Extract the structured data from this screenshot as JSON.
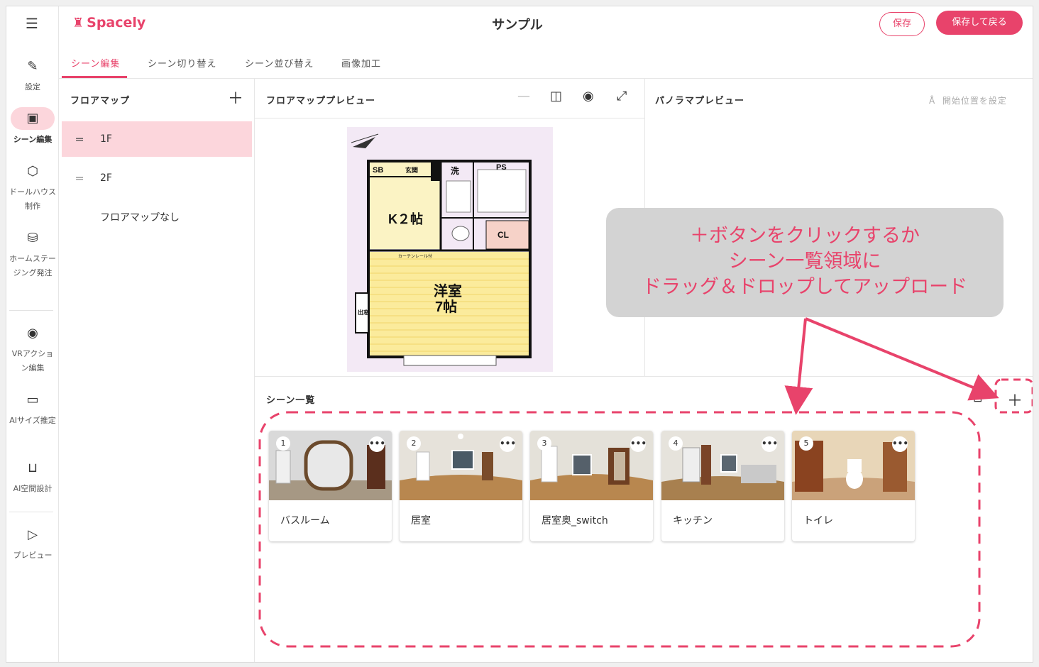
{
  "app": {
    "brand": "Spacely",
    "title": "サンプル",
    "save_label": "保存",
    "save_back_label": "保存して戻る"
  },
  "rail": {
    "items": [
      {
        "label": "設定",
        "icon": "pencil-icon"
      },
      {
        "label": "シーン編集",
        "icon": "image-icon"
      },
      {
        "label": "ドールハウス制作",
        "icon": "cube-icon"
      },
      {
        "label": "ホームステージング発注",
        "icon": "staging-icon"
      },
      {
        "label": "VRアクション編集",
        "icon": "target-icon"
      },
      {
        "label": "AIサイズ推定",
        "icon": "ruler-icon"
      },
      {
        "label": "AI空間設計",
        "icon": "sofa-icon"
      },
      {
        "label": "プレビュー",
        "icon": "play-icon"
      }
    ]
  },
  "tabs": [
    {
      "label": "シーン編集"
    },
    {
      "label": "シーン切り替え"
    },
    {
      "label": "シーン並び替え"
    },
    {
      "label": "画像加工"
    }
  ],
  "floormap": {
    "heading": "フロアマップ",
    "floors": [
      {
        "name": "1F"
      },
      {
        "name": "2F"
      },
      {
        "name": "フロアマップなし"
      }
    ]
  },
  "floor_preview": {
    "heading": "フロアマッププレビュー",
    "plan_labels": {
      "sb": "SB",
      "entrance": "玄関",
      "wash": "洗",
      "ps": "PS",
      "kitchen": "K２帖",
      "closet": "CL",
      "curtain": "カーテンレール付",
      "room": "洋室",
      "room_size": "7帖",
      "window": "出窓"
    }
  },
  "pano": {
    "heading": "パノラマプレビュー",
    "set_start_label": "開始位置を設定"
  },
  "scenes": {
    "heading": "シーン一覧",
    "items": [
      {
        "num": "1",
        "label": "バスルーム",
        "tone": "#cfcfcf"
      },
      {
        "num": "2",
        "label": "居室",
        "tone": "#b48a5a"
      },
      {
        "num": "3",
        "label": "居室奥_switch",
        "tone": "#b68c60"
      },
      {
        "num": "4",
        "label": "キッチン",
        "tone": "#a78a66"
      },
      {
        "num": "5",
        "label": "トイレ",
        "tone": "#c99a6b"
      }
    ]
  },
  "annotation": {
    "lines": [
      "＋ボタンをクリックするか",
      "シーン一覧領域に",
      "ドラッグ＆ドロップしてアップロード"
    ],
    "color": "#e8436b"
  },
  "colors": {
    "accent": "#e8436b",
    "selected_bg": "#fcd6dc"
  }
}
